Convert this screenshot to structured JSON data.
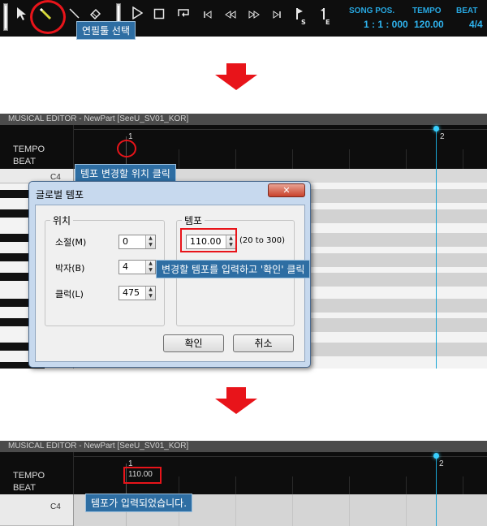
{
  "toolbar": {
    "tooltip_select_pencil": "연필툴 선택",
    "song_pos_label": "SONG POS.",
    "song_pos_value": "1 : 1 : 000",
    "tempo_label": "TEMPO",
    "tempo_value": "120.00",
    "beat_label": "BEAT",
    "beat_value": "4/4",
    "icons": [
      "cursor-arrow-icon",
      "pencil-icon",
      "line-icon",
      "eraser-icon",
      "play-icon",
      "stop-icon",
      "loop-icon",
      "go-start-icon",
      "rewind-icon",
      "fast-forward-icon",
      "go-end-icon",
      "start-marker-icon",
      "end-marker-icon"
    ],
    "icon_subscripts": {
      "start": "S",
      "end": "E"
    }
  },
  "editor1": {
    "title": "MUSICAL EDITOR - NewPart [SeeU_SV01_KOR]",
    "tempo_label": "TEMPO",
    "beat_label": "BEAT",
    "measure_1": "1",
    "measure_2": "2",
    "tooltip_click_position": "템포 변경할 위치 클릭",
    "key_c4": "C4"
  },
  "dialog": {
    "title": "글로벌 템포",
    "close_label": "✕",
    "position_group": "위치",
    "measure_label": "소절(M)",
    "measure_value": "0",
    "beat_label": "박자(B)",
    "beat_value": "4",
    "clock_label": "클럭(L)",
    "clock_value": "475",
    "tempo_group": "템포",
    "tempo_value": "110.00",
    "tempo_range": "(20 to 300)",
    "ok_button": "확인",
    "cancel_button": "취소",
    "tooltip_enter_tempo": "변경할 템포를 입력하고 '확인' 클릭"
  },
  "editor2": {
    "title": "MUSICAL EDITOR - NewPart [SeeU_SV01_KOR]",
    "tempo_label": "TEMPO",
    "beat_label": "BEAT",
    "measure_1": "1",
    "measure_2": "2",
    "tempo_marker": "110.00",
    "tooltip_tempo_entered": "템포가 입력되었습니다.",
    "key_c4": "C4"
  },
  "colors": {
    "accent_blue": "#27a7e0",
    "highlight_red": "#e8141a",
    "tooltip_bg": "#2e6ea3",
    "arrow_red": "#e8141a"
  }
}
